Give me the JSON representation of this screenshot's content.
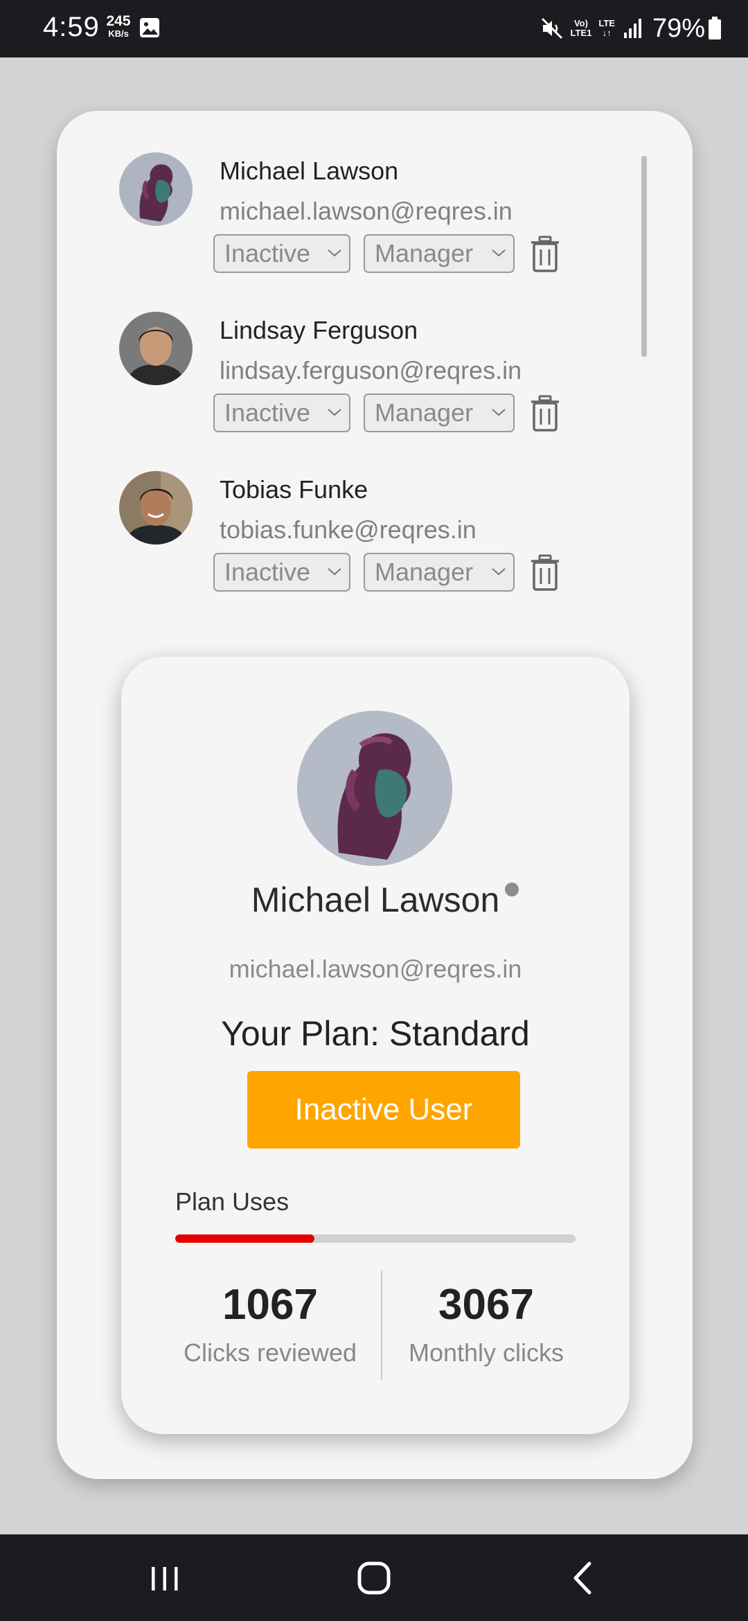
{
  "status_bar": {
    "time": "4:59",
    "speed_value": "245",
    "speed_unit": "KB/s",
    "net_label_top": "Vo)",
    "net_label_bottom": "LTE1",
    "lte_label": "LTE",
    "battery_percent": "79%"
  },
  "users": [
    {
      "name": "Michael Lawson",
      "email": "michael.lawson@reqres.in",
      "status": "Inactive",
      "role": "Manager"
    },
    {
      "name": "Lindsay Ferguson",
      "email": "lindsay.ferguson@reqres.in",
      "status": "Inactive",
      "role": "Manager"
    },
    {
      "name": "Tobias Funke",
      "email": "tobias.funke@reqres.in",
      "status": "Inactive",
      "role": "Manager"
    }
  ],
  "profile": {
    "name": "Michael Lawson",
    "email": "michael.lawson@reqres.in",
    "plan": "Your Plan: Standard",
    "status_button": "Inactive User",
    "plan_uses_label": "Plan Uses",
    "plan_uses_fraction": 0.348,
    "clicks_reviewed_value": "1067",
    "clicks_reviewed_label": "Clicks reviewed",
    "monthly_clicks_value": "3067",
    "monthly_clicks_label": "Monthly clicks"
  },
  "colors": {
    "accent_orange": "#ffa500",
    "progress_red": "#e60000",
    "status_bar_bg": "#1b1c1f"
  },
  "icons": {
    "status": [
      "image-icon",
      "mute-icon",
      "volte-icon",
      "lte-icon",
      "signal-icon",
      "battery-icon"
    ],
    "row_actions": [
      "chevron-down-icon",
      "trash-icon"
    ],
    "navigation": [
      "recent-apps-icon",
      "home-icon",
      "back-icon"
    ]
  }
}
